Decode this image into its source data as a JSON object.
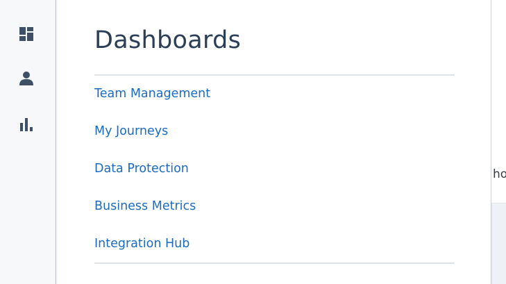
{
  "sidebar": {
    "icons": [
      {
        "name": "dashboard-icon"
      },
      {
        "name": "user-icon"
      },
      {
        "name": "bar-chart-icon"
      }
    ]
  },
  "panel": {
    "title": "Dashboards",
    "links": [
      {
        "label": "Team Management"
      },
      {
        "label": "My Journeys"
      },
      {
        "label": "Data Protection"
      },
      {
        "label": "Business Metrics"
      },
      {
        "label": "Integration Hub"
      }
    ]
  },
  "background": {
    "partial_text": "hou"
  },
  "colors": {
    "link": "#1b6bc4",
    "title": "#2a3f57",
    "icon": "#3d5066"
  }
}
